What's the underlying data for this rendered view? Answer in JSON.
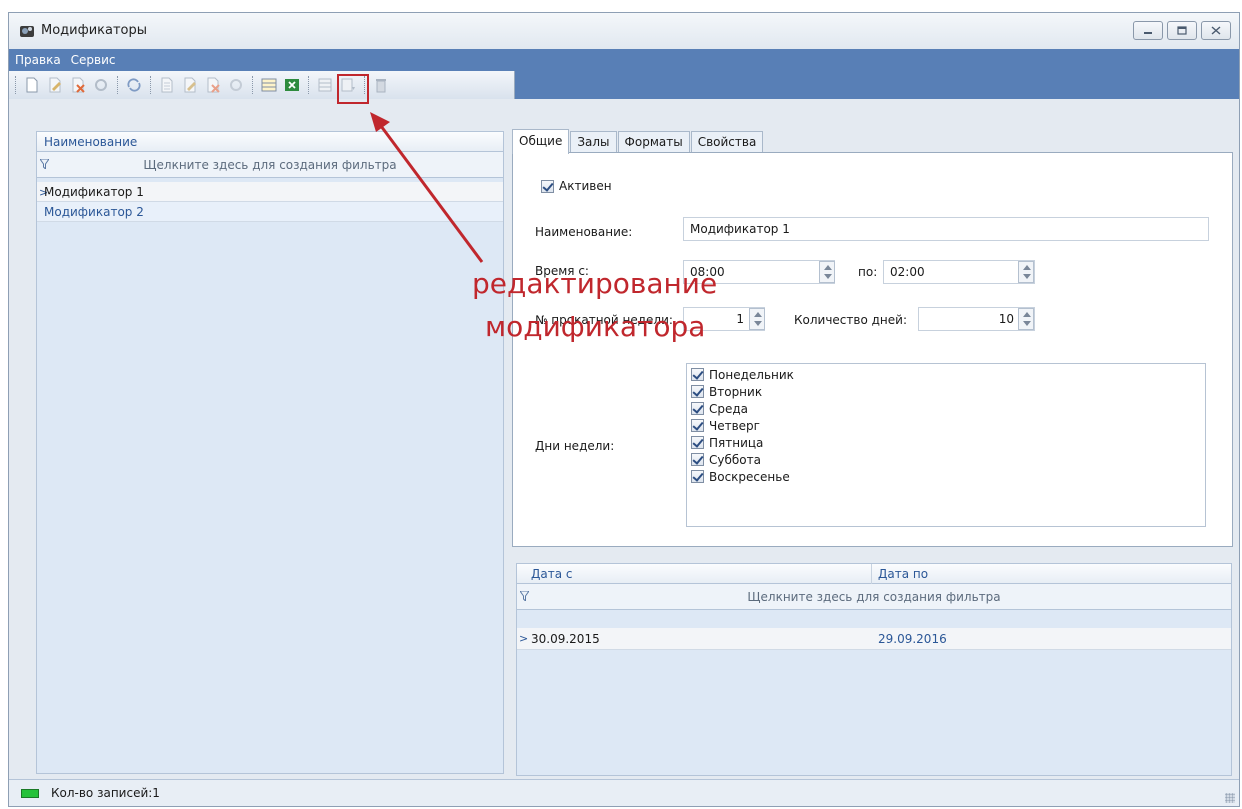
{
  "window": {
    "title": "Модификаторы"
  },
  "menu": [
    "Правка",
    "Сервис"
  ],
  "left_grid": {
    "header": "Наименование",
    "filter_hint": "Щелкните здесь для создания фильтра",
    "rows": [
      "Модификатор 1",
      "Модификатор 2"
    ]
  },
  "tabs": [
    "Общие",
    "Залы",
    "Форматы",
    "Свойства"
  ],
  "form": {
    "active_label": "Активен",
    "name_label": "Наименование:",
    "name_value": "Модификатор 1",
    "time_from_label": "Время с:",
    "time_from_value": "08:00",
    "time_to_label": "по:",
    "time_to_value": "02:00",
    "week_label": "№ прокатной недели:",
    "week_value": "1",
    "days_count_label": "Количество дней:",
    "days_count_value": "10",
    "weekdays_label": "Дни недели:",
    "weekdays": [
      "Понедельник",
      "Вторник",
      "Среда",
      "Четверг",
      "Пятница",
      "Суббота",
      "Воскресенье"
    ]
  },
  "date_grid": {
    "col_from": "Дата с",
    "col_to": "Дата по",
    "filter_hint": "Щелкните здесь для создания фильтра",
    "row_from": "30.09.2015",
    "row_to": "29.09.2016"
  },
  "annotation": {
    "line1": "редактирование",
    "line2": "модификатора"
  },
  "status": {
    "records": "Кол-во записей:1"
  },
  "colors": {
    "menubar": "#587fb6",
    "annotation": "#c0272d",
    "accent_text": "#2b5797"
  }
}
